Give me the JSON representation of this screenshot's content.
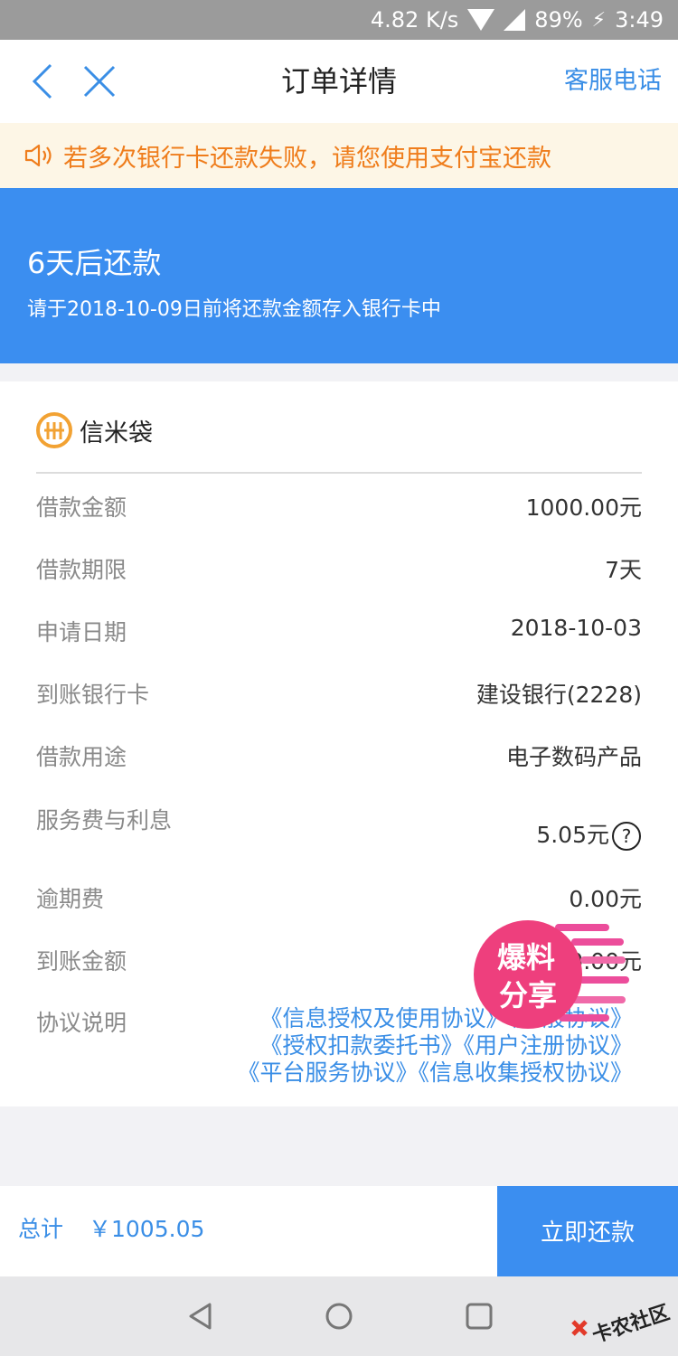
{
  "status_bar": {
    "speed": "4.82 K/s",
    "battery": "89%",
    "time": "3:49"
  },
  "header": {
    "title": "订单详情",
    "service_phone": "客服电话"
  },
  "notice": {
    "text": "若多次银行卡还款失败，请您使用支付宝还款"
  },
  "banner": {
    "title": "6天后还款",
    "subtitle": "请于2018-10-09日前将还款金额存入银行卡中"
  },
  "card": {
    "brand_name": "信米袋",
    "rows": [
      {
        "label": "借款金额",
        "value": "1000.00元"
      },
      {
        "label": "借款期限",
        "value": "7天"
      },
      {
        "label": "申请日期",
        "value": "2018-10-03"
      },
      {
        "label": "到账银行卡",
        "value": "建设银行(2228)"
      },
      {
        "label": "借款用途",
        "value": "电子数码产品"
      },
      {
        "label": "服务费与利息",
        "value": "5.05元"
      },
      {
        "label": "逾期费",
        "value": "0.00元"
      },
      {
        "label": "到账金额",
        "value": "1000.00元"
      },
      {
        "label": "协议说明",
        "value": ""
      }
    ],
    "agreements": [
      "《信息授权及使用协议》",
      "《一般协议》",
      "《授权扣款委托书》",
      "《用户注册协议》",
      "《平台服务协议》",
      "《信息收集授权协议》"
    ]
  },
  "sticker": {
    "line1": "爆料",
    "line2": "分享"
  },
  "footer": {
    "total_label": "总计",
    "total_value": "￥1005.05",
    "repay_button": "立即还款"
  },
  "corner_logo": {
    "text": "卡农社区"
  },
  "colors": {
    "accent": "#3b8ef0",
    "link": "#3a8ee6",
    "notice_text": "#ef7d1c",
    "notice_bg": "#fdf6e6"
  }
}
